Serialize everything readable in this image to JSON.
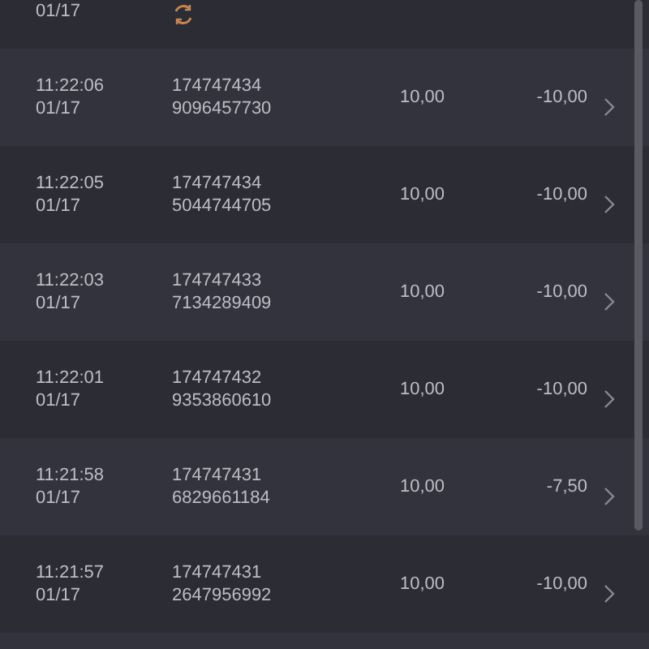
{
  "partial_row": {
    "date": "01/17",
    "pending": true
  },
  "rows": [
    {
      "time": "11:22:06",
      "date": "01/17",
      "id_line1": "174747434",
      "id_line2": "9096457730",
      "amount": "10,00",
      "net": "-10,00"
    },
    {
      "time": "11:22:05",
      "date": "01/17",
      "id_line1": "174747434",
      "id_line2": "5044744705",
      "amount": "10,00",
      "net": "-10,00"
    },
    {
      "time": "11:22:03",
      "date": "01/17",
      "id_line1": "174747433",
      "id_line2": "7134289409",
      "amount": "10,00",
      "net": "-10,00"
    },
    {
      "time": "11:22:01",
      "date": "01/17",
      "id_line1": "174747432",
      "id_line2": "9353860610",
      "amount": "10,00",
      "net": "-10,00"
    },
    {
      "time": "11:21:58",
      "date": "01/17",
      "id_line1": "174747431",
      "id_line2": "6829661184",
      "amount": "10,00",
      "net": "-7,50"
    },
    {
      "time": "11:21:57",
      "date": "01/17",
      "id_line1": "174747431",
      "id_line2": "2647956992",
      "amount": "10,00",
      "net": "-10,00"
    }
  ]
}
